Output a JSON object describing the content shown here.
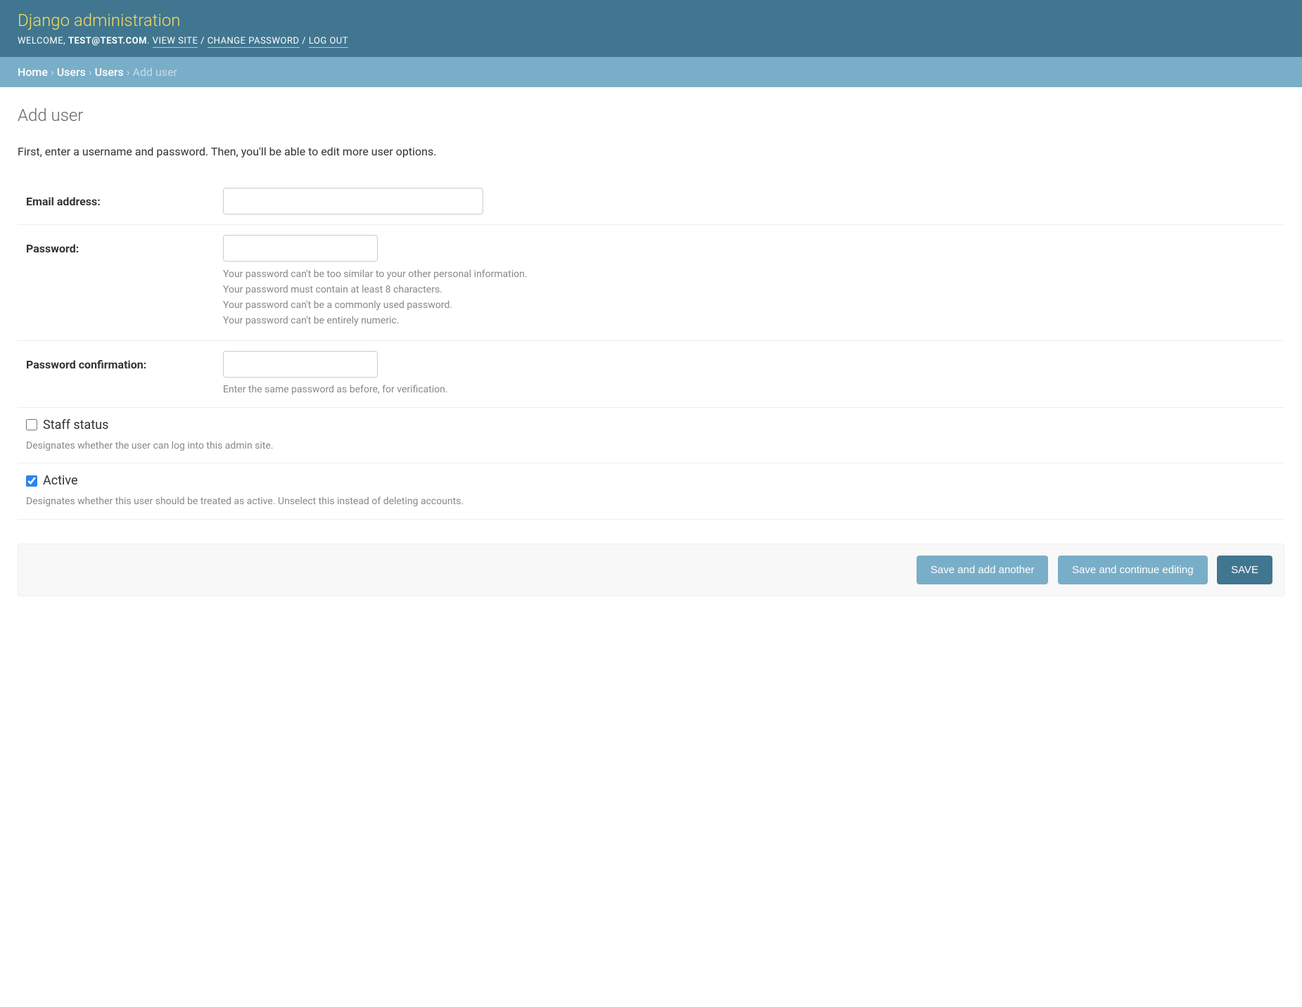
{
  "header": {
    "site_title": "Django administration",
    "welcome": "WELCOME, ",
    "username": "TEST@TEST.COM",
    "dot": ". ",
    "view_site": "VIEW SITE",
    "sep": " / ",
    "change_password": "CHANGE PASSWORD",
    "logout": "LOG OUT"
  },
  "breadcrumbs": {
    "home": "Home",
    "app": "Users",
    "model": "Users",
    "current": "Add user",
    "sep": " › "
  },
  "page": {
    "title": "Add user",
    "intro": "First, enter a username and password. Then, you'll be able to edit more user options."
  },
  "fields": {
    "email": {
      "label": "Email address:"
    },
    "password": {
      "label": "Password:",
      "help": [
        "Your password can't be too similar to your other personal information.",
        "Your password must contain at least 8 characters.",
        "Your password can't be a commonly used password.",
        "Your password can't be entirely numeric."
      ]
    },
    "password2": {
      "label": "Password confirmation:",
      "help": "Enter the same password as before, for verification."
    },
    "staff": {
      "label": "Staff status",
      "help": "Designates whether the user can log into this admin site.",
      "checked": false
    },
    "active": {
      "label": "Active",
      "help": "Designates whether this user should be treated as active. Unselect this instead of deleting accounts.",
      "checked": true
    }
  },
  "buttons": {
    "add_another": "Save and add another",
    "continue": "Save and continue editing",
    "save": "SAVE"
  }
}
